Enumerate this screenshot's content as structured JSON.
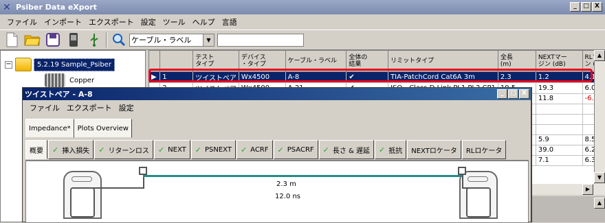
{
  "app": {
    "title": "Psiber Data eXport",
    "window_buttons": [
      "_",
      "□",
      "X"
    ]
  },
  "menubar": [
    "ファイル",
    "インポート",
    "エクスポート",
    "設定",
    "ツール",
    "ヘルプ",
    "言語"
  ],
  "toolbar": {
    "icons": [
      "new-file-icon",
      "open-folder-icon",
      "save-icon",
      "device-icon",
      "usb-icon",
      "search-icon"
    ],
    "filter_select": "ケーブル・ラベル",
    "filter_text": ""
  },
  "tree": {
    "root_expander": "−",
    "root_label": "5.2.19 Sample_Psiber",
    "child_label": "Copper"
  },
  "grid": {
    "columns": [
      "",
      "テスト\nタイプ",
      "デバイス\n・タイプ",
      "ケーブル・ラベル",
      "全体の\n結果",
      "リミットタイプ",
      "全長\n(m)",
      "NEXTマー\nジン (dB)",
      "RLマ\nン (d"
    ],
    "rows": [
      {
        "marker": "▶",
        "num": "1",
        "test_type": "ツイストペア",
        "device": "Wx4500",
        "label": "A-8",
        "result": "✔",
        "limit": "TIA-PatchCord Cat6A 3m",
        "length": "2.3",
        "next": "1.2",
        "rl": "4.1"
      },
      {
        "marker": "",
        "num": "2",
        "test_type": "ツイストペア",
        "device": "Wx4500",
        "label": "A-21",
        "result": "✔",
        "limit": "ISO - Class D Link PL1 PL2 CP1",
        "length": "19.5",
        "next": "19.3",
        "rl": "6.0"
      },
      {
        "marker": "",
        "num": "",
        "test_type": "",
        "device": "",
        "label": "",
        "result": "",
        "limit": "",
        "length": "",
        "next": "11.8",
        "rl": "-6.0"
      },
      {
        "marker": "",
        "num": "",
        "test_type": "",
        "device": "",
        "label": "",
        "result": "",
        "limit": "",
        "length": "",
        "next": "",
        "rl": ""
      },
      {
        "marker": "",
        "num": "",
        "test_type": "",
        "device": "",
        "label": "",
        "result": "",
        "limit": "",
        "length": "",
        "next": "",
        "rl": ""
      },
      {
        "marker": "",
        "num": "",
        "test_type": "",
        "device": "",
        "label": "",
        "result": "",
        "limit": "",
        "length": "",
        "next": "",
        "rl": ""
      },
      {
        "marker": "",
        "num": "",
        "test_type": "",
        "device": "",
        "label": "",
        "result": "",
        "limit": "",
        "length": "",
        "next": "5.9",
        "rl": "8.5"
      },
      {
        "marker": "",
        "num": "",
        "test_type": "",
        "device": "",
        "label": "",
        "result": "",
        "limit": "",
        "length": "",
        "next": "39.0",
        "rl": "6.2"
      },
      {
        "marker": "",
        "num": "",
        "test_type": "",
        "device": "",
        "label": "",
        "result": "",
        "limit": "",
        "length": "",
        "next": "7.1",
        "rl": "6.3"
      }
    ]
  },
  "child_window": {
    "title": "ツイストペア - A-8",
    "menu": [
      "ファイル",
      "エクスポート",
      "設定"
    ],
    "tabs_top": [
      "Impedance*",
      "Plots Overview"
    ],
    "tabs_main": [
      {
        "label": "概要",
        "check": false
      },
      {
        "label": "挿入損失",
        "check": true
      },
      {
        "label": "リターンロス",
        "check": true
      },
      {
        "label": "NEXT",
        "check": true
      },
      {
        "label": "PSNEXT",
        "check": true
      },
      {
        "label": "ACRF",
        "check": true
      },
      {
        "label": "PSACRF",
        "check": true
      },
      {
        "label": "長さ & 遅延",
        "check": true
      },
      {
        "label": "抵抗",
        "check": true
      },
      {
        "label": "NEXTロケータ",
        "check": false
      },
      {
        "label": "RLロケータ",
        "check": false
      }
    ],
    "length_value": "2.3 m",
    "delay_value": "12.0 ns"
  },
  "colors": {
    "selection": "#0a246a",
    "highlight_border": "#e8001c",
    "cable": "#208c88",
    "check": "#2aa12a",
    "negative": "#d00000"
  }
}
